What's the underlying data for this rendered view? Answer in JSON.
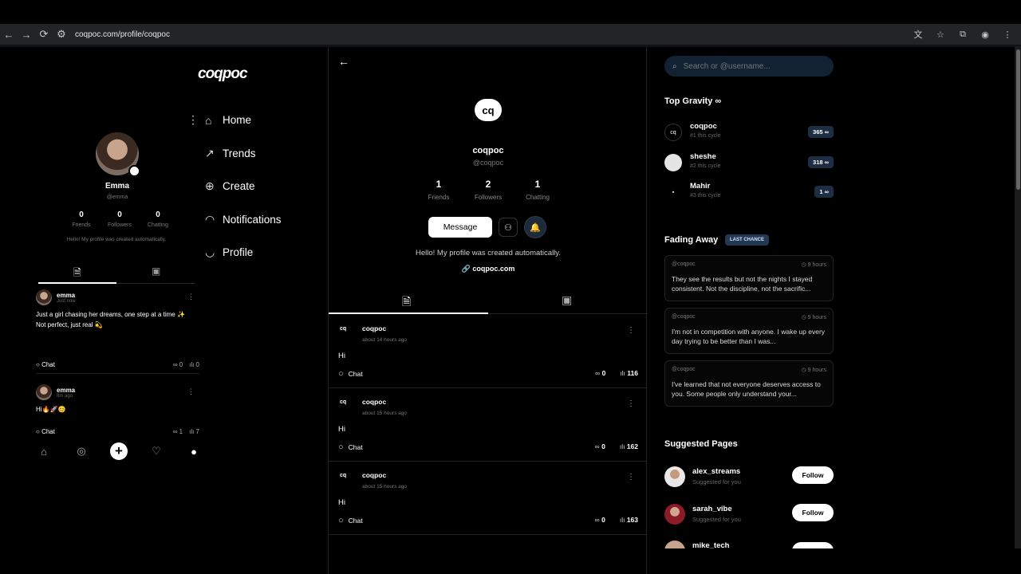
{
  "browser": {
    "url": "coqpoc.com/profile/coqpoc"
  },
  "left": {
    "logo": "coqpoc",
    "profile": {
      "name": "Emma",
      "handle": "@emma",
      "stats": [
        {
          "value": "0",
          "label": "Friends"
        },
        {
          "value": "0",
          "label": "Followers"
        },
        {
          "value": "0",
          "label": "Chatting"
        }
      ],
      "bio": "Hello! My profile was created automatically."
    },
    "nav": [
      {
        "label": "Home"
      },
      {
        "label": "Trends"
      },
      {
        "label": "Create"
      },
      {
        "label": "Notifications"
      },
      {
        "label": "Profile"
      }
    ],
    "posts": [
      {
        "name": "emma",
        "time": "Just now",
        "text": "Just a girl chasing her dreams, one step at a time ✨\nNot perfect, just real 💫",
        "chat": "Chat",
        "links": "0",
        "views": "0"
      },
      {
        "name": "emma",
        "time": "8m ago",
        "text": "Hi🔥🚀😊",
        "chat": "Chat",
        "links": "1",
        "views": "7"
      }
    ]
  },
  "center": {
    "logo_mark": "cq",
    "name": "coqpoc",
    "handle": "@coqpoc",
    "stats": [
      {
        "value": "1",
        "label": "Friends"
      },
      {
        "value": "2",
        "label": "Followers"
      },
      {
        "value": "1",
        "label": "Chatting"
      }
    ],
    "message_button": "Message",
    "bio": "Hello! My profile was created automatically.",
    "link": "coqpoc.com",
    "posts": [
      {
        "name": "coqpoc",
        "time": "about 14 hours ago",
        "text": "Hi",
        "chat": "Chat",
        "links": "0",
        "views": "116"
      },
      {
        "name": "coqpoc",
        "time": "about 15 hours ago",
        "text": "Hi",
        "chat": "Chat",
        "links": "0",
        "views": "162"
      },
      {
        "name": "coqpoc",
        "time": "about 15 hours ago",
        "text": "Hi",
        "chat": "Chat",
        "links": "0",
        "views": "163"
      }
    ]
  },
  "right": {
    "search_placeholder": "Search or @username...",
    "top_gravity_title": "Top Gravity",
    "top_gravity": [
      {
        "name": "coqpoc",
        "sub": "#1 this cycle",
        "score": "365 ∞"
      },
      {
        "name": "sheshe",
        "sub": "#2 this cycle",
        "score": "318 ∞"
      },
      {
        "name": "Mahir",
        "sub": "#3 this cycle",
        "score": "1 ∞"
      }
    ],
    "fading_title": "Fading Away",
    "fading_badge": "LAST CHANCE",
    "fading": [
      {
        "user": "@coqpoc",
        "time": "9 hours",
        "text": "They see the results but not the nights I stayed consistent. Not the discipline, not the sacrific..."
      },
      {
        "user": "@coqpoc",
        "time": "9 hours",
        "text": "I'm not in competition with anyone. I wake up every day trying to be better than I was..."
      },
      {
        "user": "@coqpoc",
        "time": "9 hours",
        "text": "I've learned that not everyone deserves access to you. Some people only understand your..."
      }
    ],
    "suggested_title": "Suggested Pages",
    "suggested": [
      {
        "name": "alex_streams",
        "sub": "Suggested for you",
        "button": "Follow"
      },
      {
        "name": "sarah_vibe",
        "sub": "Suggested for you",
        "button": "Follow"
      },
      {
        "name": "mike_tech",
        "sub": "",
        "button": ""
      }
    ]
  }
}
